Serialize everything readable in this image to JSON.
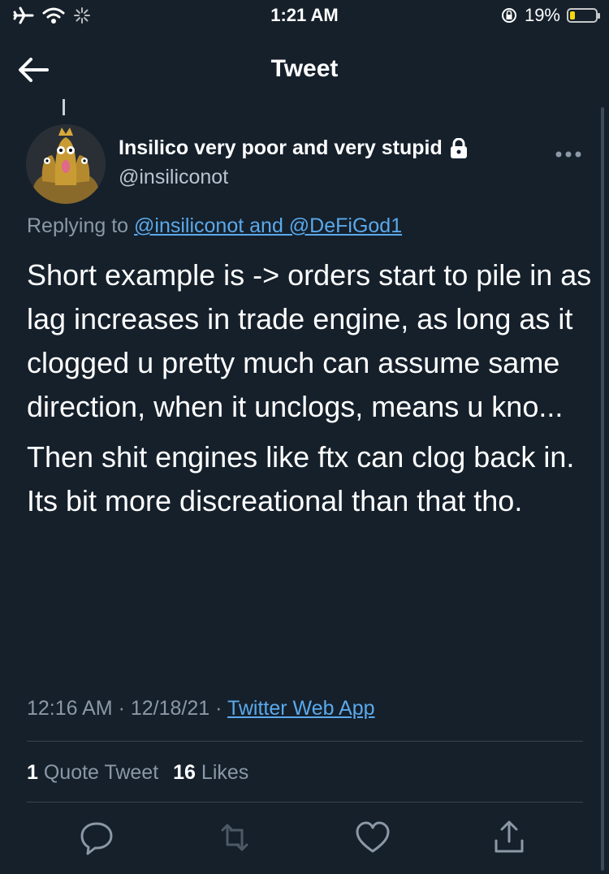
{
  "status_bar": {
    "time": "1:21 AM",
    "battery_percent": "19%",
    "battery_level": 0.19,
    "battery_color": "#f5d90a"
  },
  "header": {
    "title": "Tweet"
  },
  "tweet": {
    "author_name": "Insilico very poor and very stupid",
    "author_handle": "@insiliconot",
    "replying_prefix": "Replying to",
    "replying_to": "@insiliconot and @DeFiGod1",
    "paragraphs": [
      "Short example is -> orders start to pile in as lag increases in trade engine, as long as it clogged u pretty much can assume same direction, when it unclogs, means u kno...",
      "Then shit engines like ftx can clog back in.\nIts bit more discreational than that tho."
    ],
    "time": "12:16 AM",
    "date": "12/18/21",
    "source": "Twitter Web App",
    "quote_count": "1",
    "quote_label": "Quote Tweet",
    "like_count": "16",
    "like_label": "Likes"
  },
  "colors": {
    "background": "#15202b",
    "link": "#5ba9eb",
    "secondary_text": "#8b98a5",
    "divider": "#38444d"
  },
  "icons": [
    "airplane-icon",
    "wifi-icon",
    "activity-icon",
    "rotation-lock-icon",
    "battery-icon",
    "back-arrow-icon",
    "lock-icon",
    "more-icon",
    "reply-icon",
    "retweet-icon",
    "like-icon",
    "share-icon"
  ]
}
